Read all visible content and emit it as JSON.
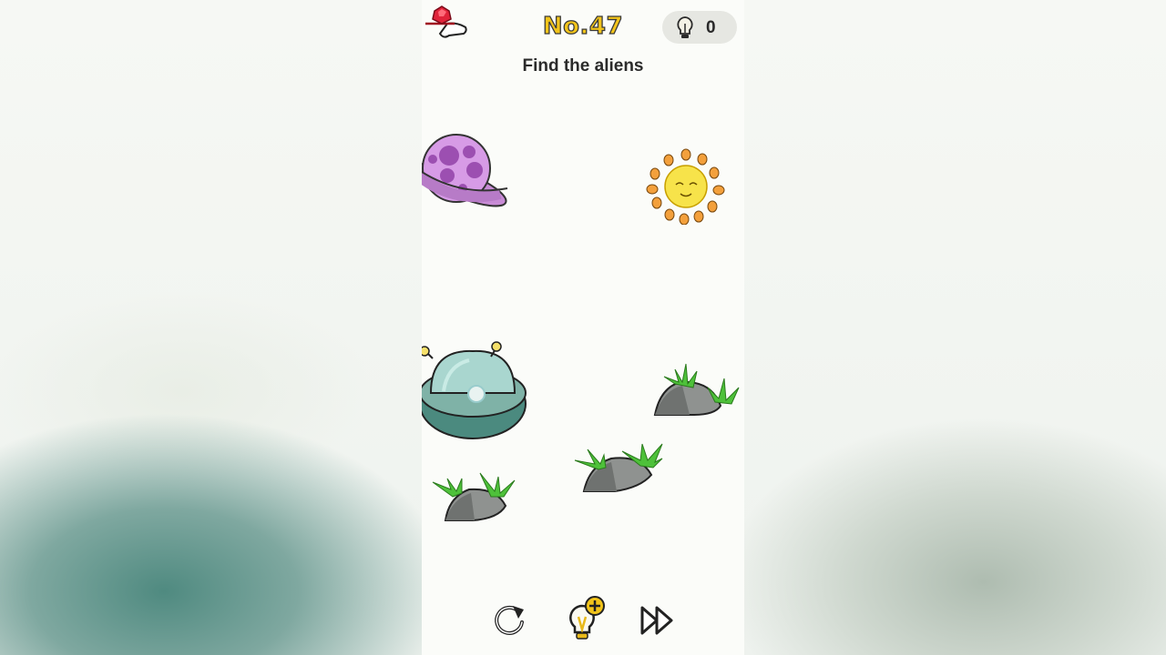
{
  "header": {
    "level_label": "No.47",
    "hint_count": "0"
  },
  "instruction": "Find the aliens",
  "scene": {
    "objects": [
      "planet",
      "sun",
      "ufo",
      "rock-with-grass",
      "rock-with-grass",
      "rock-with-grass"
    ]
  },
  "controls": {
    "icons": [
      "restart-icon",
      "hint-plus-icon",
      "skip-icon"
    ]
  },
  "colors": {
    "title_yellow": "#f2c41a",
    "planet_purple": "#d79be6",
    "sun_yellow": "#f7e34a",
    "sun_orange": "#f3a03c",
    "ufo_teal": "#a9d6cf",
    "ufo_dark": "#4b8a7f",
    "grass_green": "#4ec13a",
    "rock_gray": "#8f9290",
    "gem_red": "#e0233a"
  }
}
